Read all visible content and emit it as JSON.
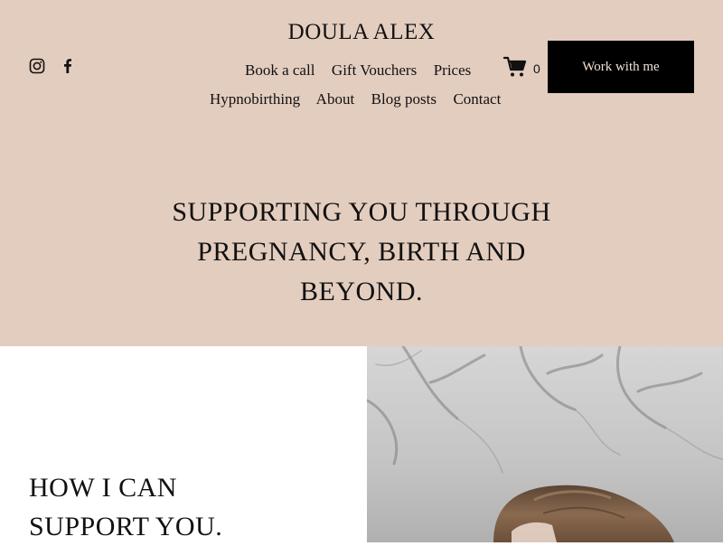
{
  "header": {
    "brand": "DOULA ALEX",
    "social": [
      "instagram-icon",
      "facebook-icon"
    ],
    "nav_row1": [
      "Book a call",
      "Gift Vouchers",
      "Prices"
    ],
    "nav_row2": [
      "Hypnobirthing",
      "About",
      "Blog posts",
      "Contact"
    ],
    "cart_count": "0",
    "cta_label": "Work with me"
  },
  "hero": {
    "line1": "SUPPORTING YOU THROUGH",
    "line2": "PREGNANCY, BIRTH AND",
    "line3": "BEYOND."
  },
  "section": {
    "heading_line1": "HOW I CAN",
    "heading_line2": "SUPPORT YOU."
  },
  "colors": {
    "header_bg": "#e3cdbf",
    "button_bg": "#000000",
    "button_text": "#f2e1d3"
  }
}
